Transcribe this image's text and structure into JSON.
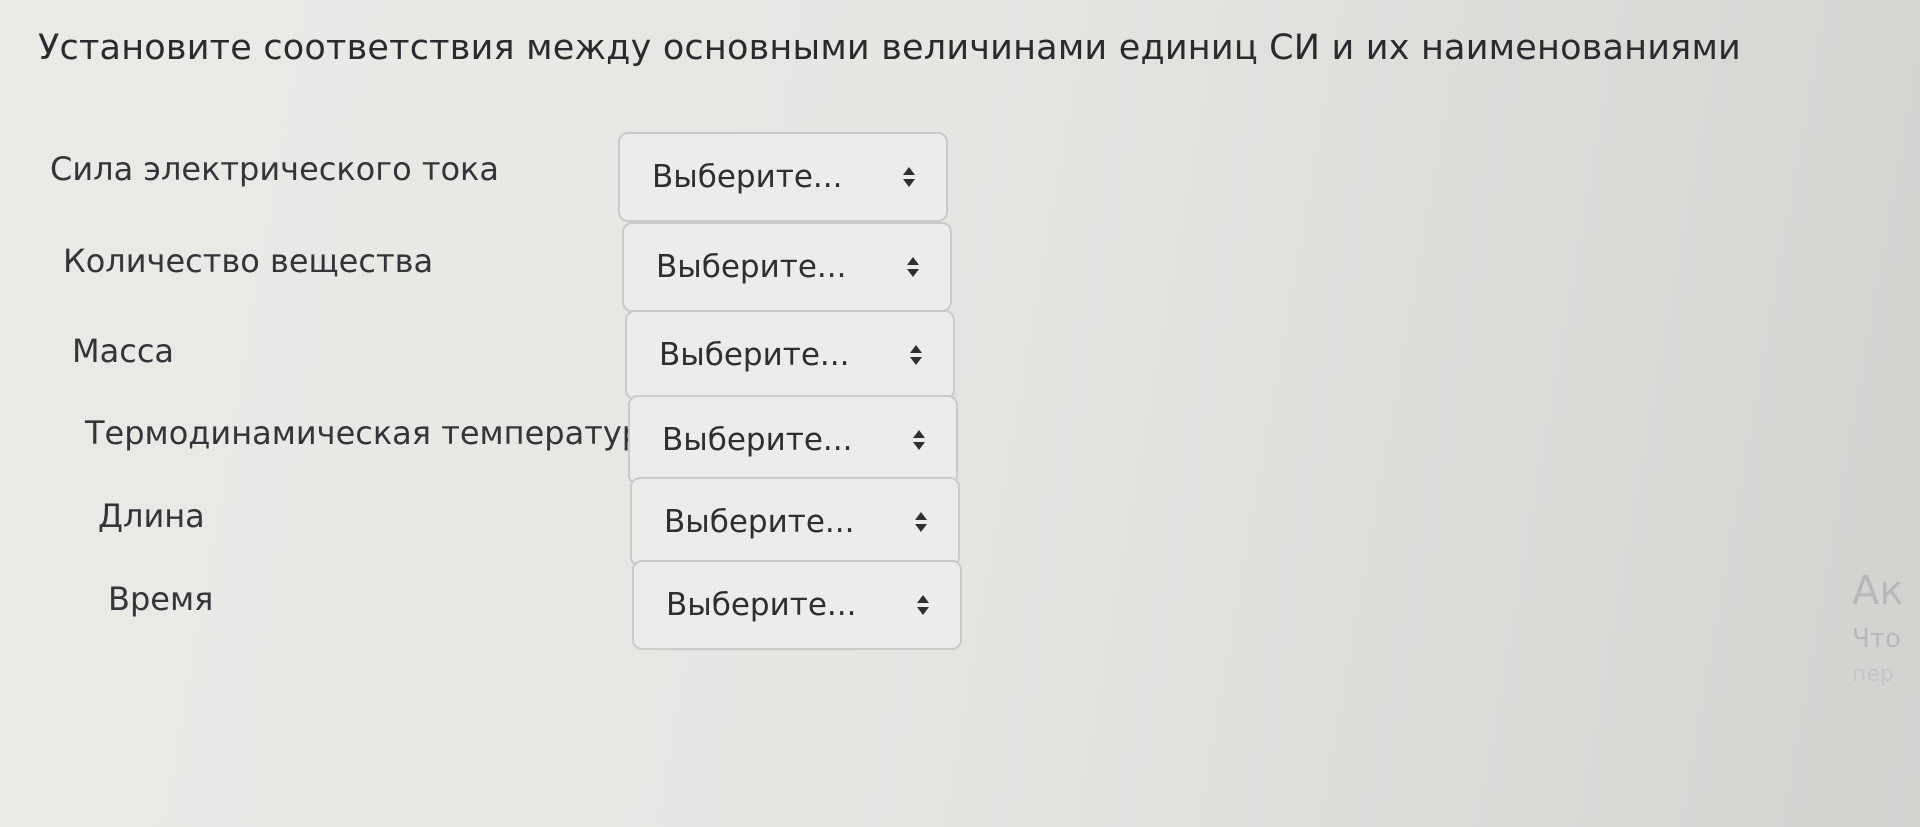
{
  "question": {
    "text": "Установите соответствия между основными величинами единиц СИ и их наименованиями"
  },
  "rows": [
    {
      "label": "Сила электрического тока",
      "select_value": "Выберите..."
    },
    {
      "label": "Количество вещества",
      "select_value": "Выберите..."
    },
    {
      "label": "Масса",
      "select_value": "Выберите..."
    },
    {
      "label": "Термодинамическая температура",
      "select_value": "Выберите..."
    },
    {
      "label": "Длина",
      "select_value": "Выберите..."
    },
    {
      "label": "Время",
      "select_value": "Выберите..."
    }
  ],
  "icons": {
    "select_arrows": "up-down-chevron-icon"
  },
  "partial_overlay": {
    "line1": "Ак",
    "line2": "Что",
    "line3": "пер"
  },
  "colors": {
    "background": "#e6e6e3",
    "text": "#2e2f33",
    "select_border": "#c9cacb",
    "select_background": "#ececea"
  }
}
